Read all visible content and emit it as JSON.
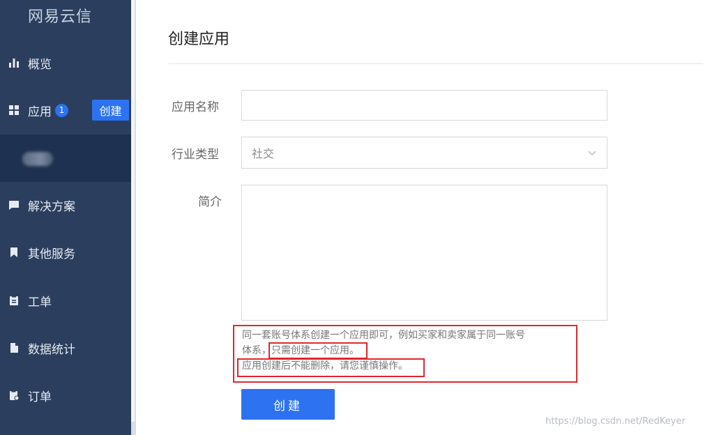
{
  "sidebar": {
    "logo": "网易云信",
    "items": [
      {
        "label": "概览"
      },
      {
        "label": "应用",
        "badge": "1",
        "action": "创建"
      },
      {
        "label": "解决方案"
      },
      {
        "label": "其他服务"
      },
      {
        "label": "工单"
      },
      {
        "label": "数据统计"
      },
      {
        "label": "订单"
      }
    ]
  },
  "main": {
    "title": "创建应用",
    "form": {
      "name_label": "应用名称",
      "name_value": "",
      "industry_label": "行业类型",
      "industry_value": "社交",
      "intro_label": "简介",
      "intro_value": ""
    },
    "hint": {
      "line1": "同一套账号体系创建一个应用即可，例如买家和卖家属于同一账号",
      "line2_prefix": "体系，",
      "line2_emph": "只需创建一个应用。",
      "line3": "应用创建后不能删除，请您谨慎操作。"
    },
    "submit_label": "创建"
  },
  "watermark": "https://blog.csdn.net/RedKeyer",
  "colors": {
    "sidebar": "#2b3e5e",
    "accent": "#2d72f0",
    "highlight": "#e0262d"
  }
}
